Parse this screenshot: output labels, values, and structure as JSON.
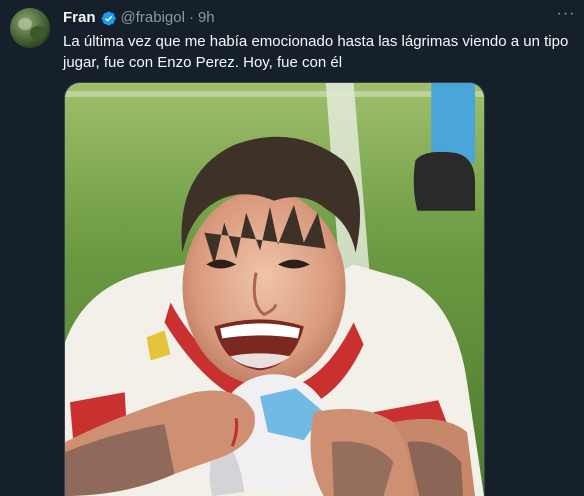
{
  "tweet": {
    "author_name": "Fran",
    "handle": "@frabigol",
    "separator": "·",
    "time": "9h",
    "text": "La última vez que me había emocionado hasta las lágrimas viendo a un tipo jugar, fue con Enzo Perez. Hoy, fue con él",
    "more_label": "···"
  },
  "icons": {
    "verified": "verified-badge-icon",
    "more": "more-options-icon"
  },
  "colors": {
    "background": "#15202b",
    "primary_text": "#f7f9f9",
    "secondary_text": "#8b98a5",
    "verified": "#1d9bf0",
    "border": "#38444d"
  }
}
